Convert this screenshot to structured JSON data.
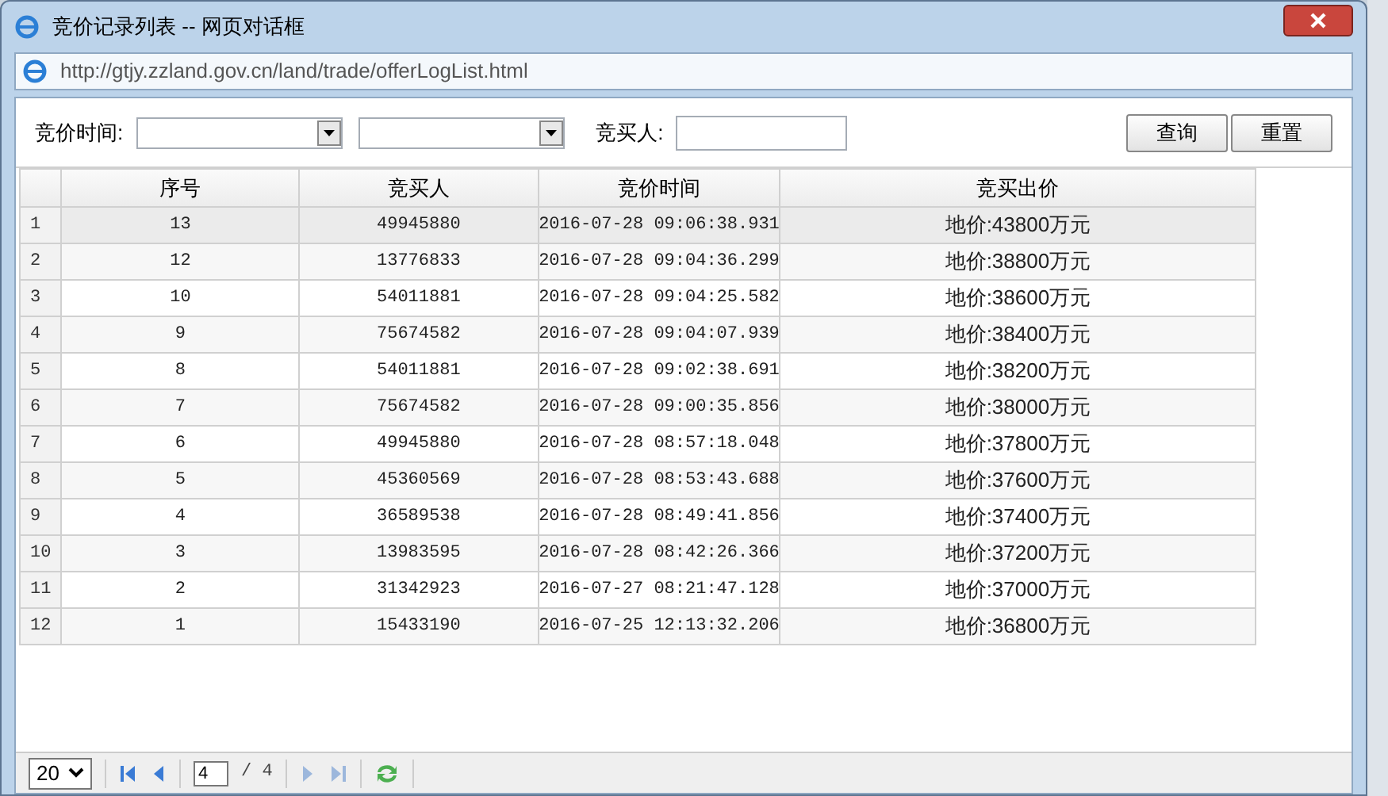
{
  "window": {
    "title": "竞价记录列表 -- 网页对话框",
    "url": "http://gtjy.zzland.gov.cn/land/trade/offerLogList.html"
  },
  "filters": {
    "time_label": "竞价时间:",
    "buyer_label": "竞买人:",
    "buttons": [
      "查询",
      "重置"
    ]
  },
  "table": {
    "columns": [
      "序号",
      "竞买人",
      "竞价时间",
      "竞买出价"
    ],
    "rows": [
      {
        "n": "1",
        "cells": [
          "13",
          "49945880",
          "2016-07-28 09:06:38.931",
          "地价:43800万元"
        ],
        "selected": true
      },
      {
        "n": "2",
        "cells": [
          "12",
          "13776833",
          "2016-07-28 09:04:36.299",
          "地价:38800万元"
        ],
        "selected": false
      },
      {
        "n": "3",
        "cells": [
          "10",
          "54011881",
          "2016-07-28 09:04:25.582",
          "地价:38600万元"
        ],
        "selected": false
      },
      {
        "n": "4",
        "cells": [
          "9",
          "75674582",
          "2016-07-28 09:04:07.939",
          "地价:38400万元"
        ],
        "selected": false
      },
      {
        "n": "5",
        "cells": [
          "8",
          "54011881",
          "2016-07-28 09:02:38.691",
          "地价:38200万元"
        ],
        "selected": false
      },
      {
        "n": "6",
        "cells": [
          "7",
          "75674582",
          "2016-07-28 09:00:35.856",
          "地价:38000万元"
        ],
        "selected": false
      },
      {
        "n": "7",
        "cells": [
          "6",
          "49945880",
          "2016-07-28 08:57:18.048",
          "地价:37800万元"
        ],
        "selected": false
      },
      {
        "n": "8",
        "cells": [
          "5",
          "45360569",
          "2016-07-28 08:53:43.688",
          "地价:37600万元"
        ],
        "selected": false
      },
      {
        "n": "9",
        "cells": [
          "4",
          "36589538",
          "2016-07-28 08:49:41.856",
          "地价:37400万元"
        ],
        "selected": false
      },
      {
        "n": "10",
        "cells": [
          "3",
          "13983595",
          "2016-07-28 08:42:26.366",
          "地价:37200万元"
        ],
        "selected": false
      },
      {
        "n": "11",
        "cells": [
          "2",
          "31342923",
          "2016-07-27 08:21:47.128",
          "地价:37000万元"
        ],
        "selected": false
      },
      {
        "n": "12",
        "cells": [
          "1",
          "15433190",
          "2016-07-25 12:13:32.206",
          "地价:36800万元"
        ],
        "selected": false
      }
    ]
  },
  "pager": {
    "page_size": "20",
    "page": "4",
    "total": "/ 4"
  }
}
